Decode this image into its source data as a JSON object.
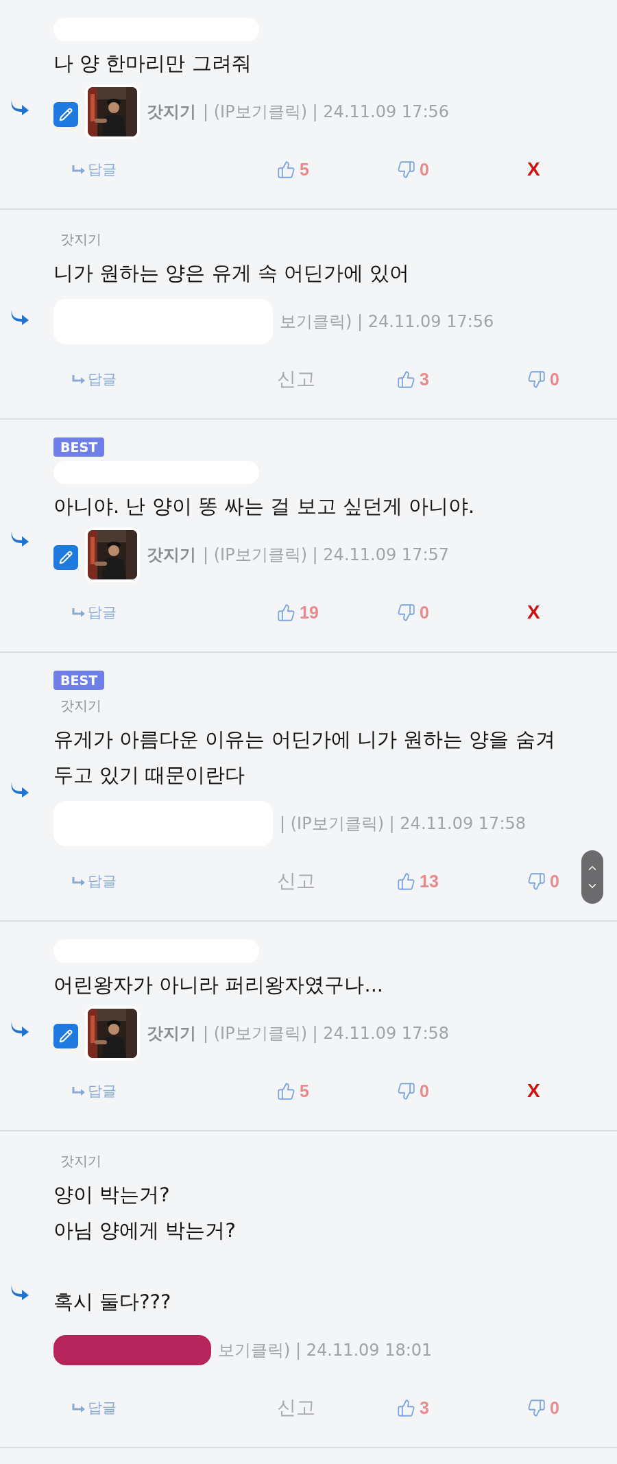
{
  "comments": [
    {
      "best": false,
      "mention": {
        "kind": "redacted",
        "color": "#ffffff"
      },
      "paragraphs": [
        [
          "나 양 한마리만 그려줘"
        ]
      ],
      "author": {
        "kind": "own",
        "name": "갓지기"
      },
      "meta": "| (IP보기클릭) | 24.11.09 17:56",
      "actions": [
        {
          "kind": "reply",
          "text": "답글"
        },
        {
          "kind": "like",
          "count": "5"
        },
        {
          "kind": "dislike",
          "count": "0"
        },
        {
          "kind": "delete",
          "text": "X"
        }
      ]
    },
    {
      "best": false,
      "mention": {
        "kind": "text",
        "text": "갓지기"
      },
      "paragraphs": [
        [
          "니가 원하는 양은 유게 속 어딘가에 있어"
        ]
      ],
      "author": {
        "kind": "redacted",
        "color": "#ffffff"
      },
      "meta": "보기클릭) | 24.11.09 17:56",
      "actions": [
        {
          "kind": "reply",
          "text": "답글"
        },
        {
          "kind": "report",
          "text": "신고"
        },
        {
          "kind": "like",
          "count": "3"
        },
        {
          "kind": "dislike",
          "count": "0"
        }
      ]
    },
    {
      "best": true,
      "badge": "BEST",
      "mention": {
        "kind": "redacted",
        "color": "#ffffff"
      },
      "paragraphs": [
        [
          "아니야. 난 양이 똥 싸는 걸 보고 싶던게 아니야."
        ]
      ],
      "author": {
        "kind": "own",
        "name": "갓지기"
      },
      "meta": "| (IP보기클릭) | 24.11.09 17:57",
      "actions": [
        {
          "kind": "reply",
          "text": "답글"
        },
        {
          "kind": "like",
          "count": "19"
        },
        {
          "kind": "dislike",
          "count": "0"
        },
        {
          "kind": "delete",
          "text": "X"
        }
      ]
    },
    {
      "best": true,
      "badge": "BEST",
      "mention": {
        "kind": "text",
        "text": "갓지기"
      },
      "paragraphs": [
        [
          "유게가 아름다운 이유는 어딘가에 니가 원하는 양을 숨겨",
          "두고 있기 때문이란다"
        ]
      ],
      "author": {
        "kind": "redacted",
        "color": "#ffffff"
      },
      "meta": "| (IP보기클릭) | 24.11.09 17:58",
      "actions": [
        {
          "kind": "reply",
          "text": "답글"
        },
        {
          "kind": "report",
          "text": "신고"
        },
        {
          "kind": "like",
          "count": "13"
        },
        {
          "kind": "dislike",
          "count": "0"
        }
      ]
    },
    {
      "best": false,
      "mention": {
        "kind": "redacted",
        "color": "#ffffff"
      },
      "paragraphs": [
        [
          "어린왕자가 아니라 퍼리왕자였구나..."
        ]
      ],
      "author": {
        "kind": "own",
        "name": "갓지기"
      },
      "meta": "| (IP보기클릭) | 24.11.09 17:58",
      "actions": [
        {
          "kind": "reply",
          "text": "답글"
        },
        {
          "kind": "like",
          "count": "5"
        },
        {
          "kind": "dislike",
          "count": "0"
        },
        {
          "kind": "delete",
          "text": "X"
        }
      ]
    },
    {
      "best": false,
      "mention": {
        "kind": "text",
        "text": "갓지기"
      },
      "paragraphs": [
        [
          "양이 박는거?",
          "아님 양에게 박는거?"
        ],
        [
          "혹시 둘다???"
        ]
      ],
      "author": {
        "kind": "redacted",
        "color": "#b5245a"
      },
      "meta": "보기클릭) | 24.11.09 18:01",
      "actions": [
        {
          "kind": "reply",
          "text": "답글"
        },
        {
          "kind": "report",
          "text": "신고"
        },
        {
          "kind": "like",
          "count": "3"
        },
        {
          "kind": "dislike",
          "count": "0"
        }
      ]
    }
  ]
}
